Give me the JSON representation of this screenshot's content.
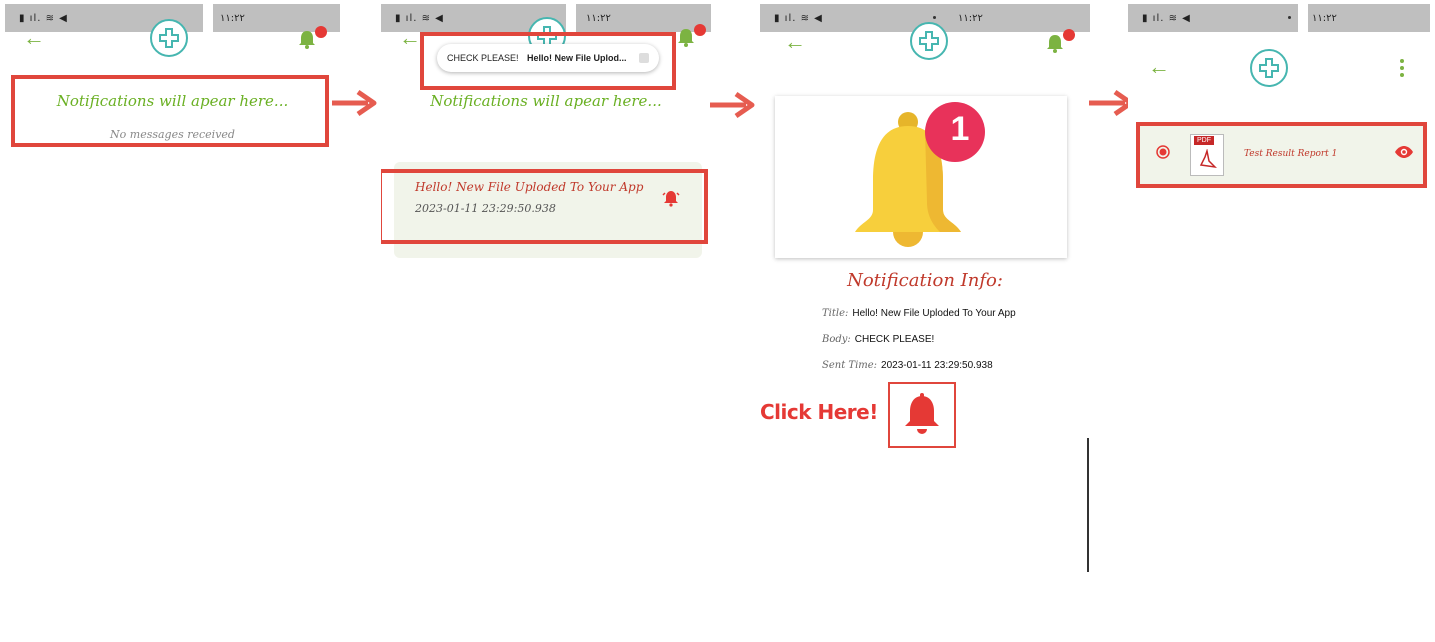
{
  "statusbar": {
    "time": "١١:٢٢",
    "signal": "▮ ıl. ≋ ◀"
  },
  "screen1": {
    "placeholder_title": "Notifications will apear here...",
    "empty_message": "No messages received"
  },
  "screen2": {
    "toast_title": "CHECK PLEASE!",
    "toast_body": "Hello! New File Uplod...",
    "placeholder_title": "Notifications will apear here...",
    "notification_title": "Hello! New File Uploded To Your App",
    "notification_time": "2023-01-11 23:29:50.938"
  },
  "screen3": {
    "badge_count": "1",
    "info_heading": "Notification Info:",
    "title_key": "Title:",
    "title_value": "Hello! New File Uploded To Your App",
    "body_key": "Body:",
    "body_value": "CHECK PLEASE!",
    "sent_key": "Sent Time:",
    "sent_value": "2023-01-11 23:29:50.938",
    "click_here": "Click Here!"
  },
  "screen4": {
    "file_name": "Test Result Report 1",
    "pdf_label": "PDF"
  },
  "colors": {
    "accent_green": "#6ab023",
    "highlight_red": "#e0463c",
    "bell_yellow": "#f7cf3c",
    "badge_pink": "#e8325a"
  }
}
